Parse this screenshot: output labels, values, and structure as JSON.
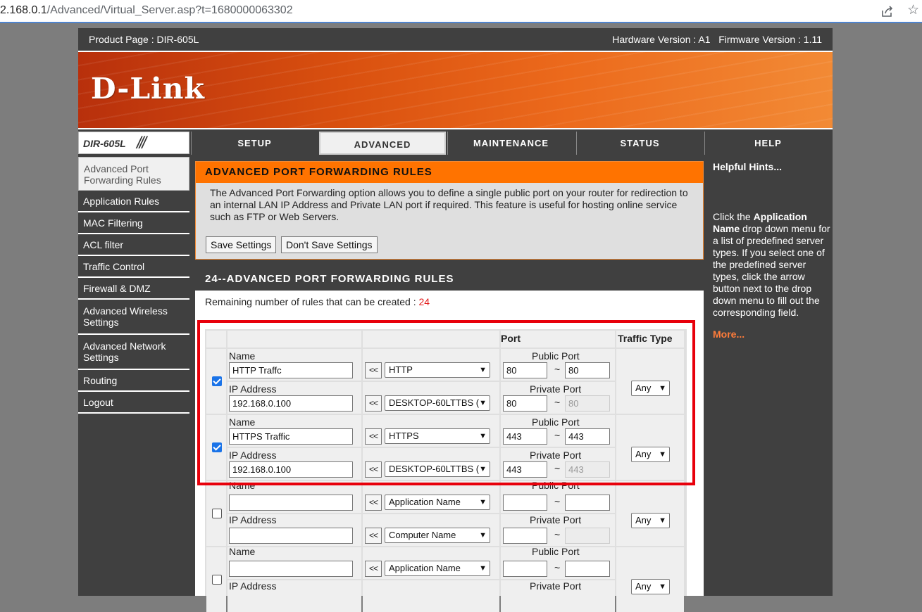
{
  "browser": {
    "url_host": "2.168.0.1",
    "url_path": "/Advanced/Virtual_Server.asp?t=1680000063302"
  },
  "header": {
    "product_page": "Product Page : DIR-605L",
    "versions": "Hardware Version : A1   Firmware Version : 1.11",
    "logo": "D-Link",
    "model": "DIR-605L",
    "model_slashes": "///"
  },
  "tabs": [
    {
      "label": "SETUP",
      "active": false
    },
    {
      "label": "ADVANCED",
      "active": true
    },
    {
      "label": "MAINTENANCE",
      "active": false
    },
    {
      "label": "STATUS",
      "active": false
    },
    {
      "label": "HELP",
      "active": false
    }
  ],
  "sidebar": {
    "items": [
      {
        "label": "Advanced Port Forwarding Rules",
        "active": true
      },
      {
        "label": "Application Rules"
      },
      {
        "label": "MAC Filtering"
      },
      {
        "label": "ACL filter"
      },
      {
        "label": "Traffic Control"
      },
      {
        "label": "Firewall & DMZ"
      },
      {
        "label": "Advanced Wireless Settings"
      },
      {
        "label": "Advanced Network Settings"
      },
      {
        "label": "Routing"
      },
      {
        "label": "Logout"
      }
    ]
  },
  "intro": {
    "title": "ADVANCED PORT FORWARDING RULES",
    "description": "The Advanced Port Forwarding option allows you to define a single public port on your router for redirection to an internal LAN IP Address and Private LAN port if required. This feature is useful for hosting online service such as FTP or Web Servers.",
    "save_label": "Save Settings",
    "dont_save_label": "Don't Save Settings"
  },
  "rules": {
    "title": "24--ADVANCED PORT FORWARDING RULES",
    "remaining_label": "Remaining number of rules that can be created : ",
    "remaining_count": "24",
    "col_port": "Port",
    "col_traffic": "Traffic Type",
    "name_label": "Name",
    "ip_label": "IP Address",
    "public_port_label": "Public Port",
    "private_port_label": "Private Port",
    "arrow_label": "<<",
    "tilde": "~",
    "rows": [
      {
        "checked": true,
        "name": "HTTP Traffc",
        "app": "HTTP",
        "ip": "192.168.0.100",
        "computer": "DESKTOP-60LTTBS (",
        "pub_start": "80",
        "pub_end": "80",
        "priv_start": "80",
        "priv_end": "80",
        "traffic": "Any"
      },
      {
        "checked": true,
        "name": "HTTPS Traffic",
        "app": "HTTPS",
        "ip": "192.168.0.100",
        "computer": "DESKTOP-60LTTBS (",
        "pub_start": "443",
        "pub_end": "443",
        "priv_start": "443",
        "priv_end": "443",
        "traffic": "Any"
      },
      {
        "checked": false,
        "name": "",
        "app": "Application Name",
        "ip": "",
        "computer": "Computer Name",
        "pub_start": "",
        "pub_end": "",
        "priv_start": "",
        "priv_end": "",
        "traffic": "Any"
      },
      {
        "checked": false,
        "name": "",
        "app": "Application Name",
        "ip": "",
        "computer": "",
        "pub_start": "",
        "pub_end": "",
        "priv_start": "",
        "priv_end": "",
        "traffic": "Any"
      }
    ]
  },
  "hints": {
    "title": "Helpful Hints...",
    "body_1": "Click the ",
    "body_bold": "Application Name",
    "body_2": " drop down menu for a list of predefined server types. If you select one of the predefined server types, click the arrow button next to the drop down menu to fill out the corresponding field.",
    "more": "More..."
  },
  "colors": {
    "accent_orange": "#ff7300",
    "highlight_red": "#e8000b",
    "checkbox_blue": "#1a73e8",
    "remaining_red": "#e21a1a"
  }
}
